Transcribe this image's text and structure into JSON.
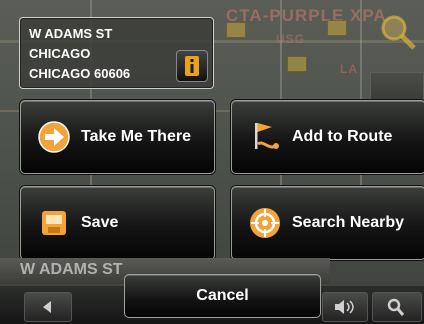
{
  "map": {
    "labels": [
      "CTA-PURPLE XPA",
      "USG",
      "LA"
    ],
    "street_bar": "W ADAMS ST"
  },
  "address": {
    "line1": "W ADAMS ST",
    "line2": "CHICAGO",
    "line3": "CHICAGO 60606",
    "info_icon": "info-icon"
  },
  "actions": {
    "take_me_there": {
      "label": "Take Me There",
      "icon": "arrow-right-circle-icon"
    },
    "add_to_route": {
      "label": "Add to Route",
      "icon": "flag-route-icon"
    },
    "save": {
      "label": "Save",
      "icon": "save-icon"
    },
    "search_nearby": {
      "label": "Search Nearby",
      "icon": "target-icon"
    }
  },
  "cancel_label": "Cancel",
  "colors": {
    "accent": "#f5a623",
    "text": "#ffffff"
  }
}
